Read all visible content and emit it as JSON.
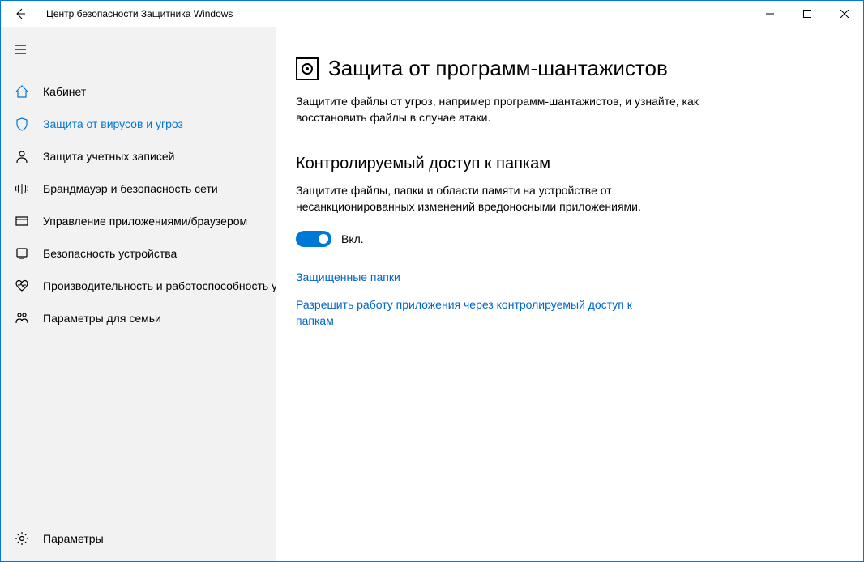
{
  "window": {
    "title": "Центр безопасности Защитника Windows"
  },
  "sidebar": {
    "items": [
      {
        "label": "Кабинет",
        "icon": "home"
      },
      {
        "label": "Защита от вирусов и угроз",
        "icon": "shield",
        "active": true
      },
      {
        "label": "Защита учетных записей",
        "icon": "person"
      },
      {
        "label": "Брандмауэр и безопасность сети",
        "icon": "signal"
      },
      {
        "label": "Управление приложениями/браузером",
        "icon": "app"
      },
      {
        "label": "Безопасность устройства",
        "icon": "device"
      },
      {
        "label": "Производительность и работоспособность устройства",
        "icon": "heart"
      },
      {
        "label": "Параметры для семьи",
        "icon": "family"
      }
    ],
    "settings_label": "Параметры"
  },
  "main": {
    "title": "Защита от программ-шантажистов",
    "desc": "Защитите файлы от угроз, например программ-шантажистов, и узнайте, как восстановить файлы в случае атаки.",
    "section": {
      "title": "Контролируемый доступ к папкам",
      "desc": "Защитите файлы, папки и области памяти на устройстве от несанкционированных изменений вредоносными приложениями.",
      "toggle_label": "Вкл.",
      "toggle_on": true
    },
    "links": {
      "protected_folders": "Защищенные папки",
      "allow_app": "Разрешить работу приложения через контролируемый доступ к папкам"
    }
  }
}
